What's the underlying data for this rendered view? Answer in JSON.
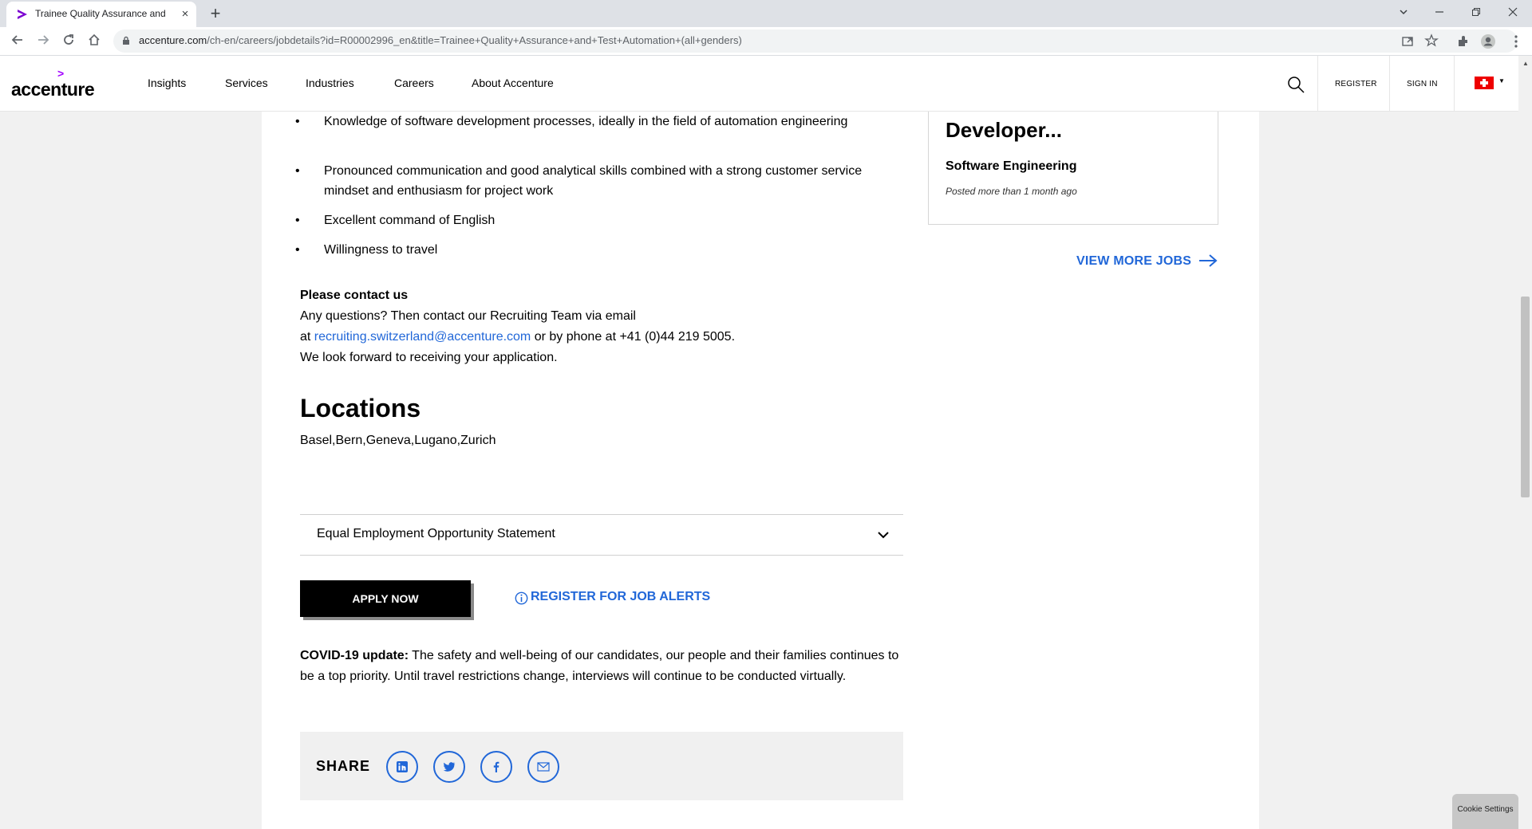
{
  "browser": {
    "tab_title": "Trainee Quality Assurance and Test Automation (all genders)",
    "tab_close": "×",
    "new_tab": "+",
    "url_host": "accenture.com",
    "url_path": "/ch-en/careers/jobdetails?id=R00002996_en&title=Trainee+Quality+Assurance+and+Test+Automation+(all+genders)"
  },
  "header": {
    "logo_mark": ">",
    "logo_text": "accenture",
    "nav": [
      "Insights",
      "Services",
      "Industries",
      "Careers",
      "About Accenture"
    ],
    "register": "REGISTER",
    "sign_in": "SIGN IN"
  },
  "requirements": [
    "Knowledge of software development processes, ideally in the field of automation engineering",
    "Pronounced communication and good analytical skills combined with a strong customer service mindset and enthusiasm for project work",
    "Excellent command of English",
    "Willingness to travel"
  ],
  "contact": {
    "title": "Please contact us",
    "line1": "Any questions? Then contact our Recruiting Team via email",
    "line2_prefix": "at ",
    "email": "recruiting.switzerland@accenture.com",
    "line2_suffix": " or by phone at +41 (0)44 219 5005.",
    "line3": "We look forward to receiving your application."
  },
  "locations": {
    "title": "Locations",
    "value": "Basel,Bern,Geneva,Lugano,Zurich"
  },
  "accordion": {
    "label": "Equal Employment Opportunity Statement"
  },
  "apply": {
    "label": "APPLY NOW"
  },
  "alerts": {
    "label": "REGISTER FOR JOB ALERTS"
  },
  "covid": {
    "bold": "COVID-19 update:",
    "text": "  The safety and well-being of our candidates, our people and their families continues to be a top priority. Until travel restrictions change, interviews will continue to be conducted virtually."
  },
  "share": {
    "label": "SHARE",
    "icons": [
      "linkedin-icon",
      "twitter-icon",
      "facebook-icon",
      "email-icon"
    ]
  },
  "related_job": {
    "title": "Developer...",
    "category": "Software Engineering",
    "posted": "Posted more than 1 month ago"
  },
  "view_more": {
    "label": "VIEW MORE JOBS"
  },
  "cookie": {
    "label": "Cookie Settings"
  },
  "colors": {
    "accent": "#a100ff",
    "link": "#2167d8",
    "flag": "#ee0000"
  }
}
